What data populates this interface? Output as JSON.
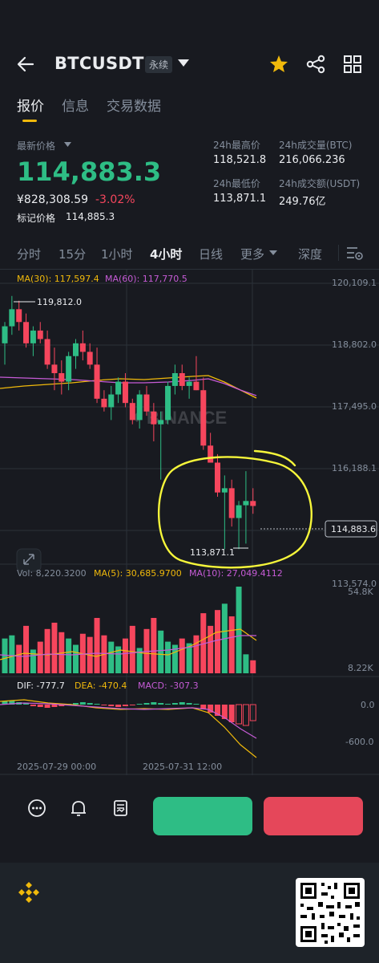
{
  "header": {
    "symbol": "BTCUSDT",
    "contract_type": "永续",
    "icons": [
      "back-arrow-icon",
      "dropdown-caret-icon",
      "star-icon",
      "share-icon",
      "grid-icon"
    ],
    "favorite_color": "#f0b90b"
  },
  "top_tabs": [
    {
      "label": "报价",
      "active": true
    },
    {
      "label": "信息",
      "active": false
    },
    {
      "label": "交易数据",
      "active": false
    }
  ],
  "price": {
    "last_price_label": "最新价格",
    "last_price": "114,883.3",
    "cny_price": "¥828,308.59",
    "change_pct": "-3.02%",
    "mark_label": "标记价格",
    "mark_value": "114,885.3"
  },
  "stats": {
    "high_label": "24h最高价",
    "high": "118,521.8",
    "low_label": "24h最低价",
    "low": "113,871.1",
    "vol_btc_label": "24h成交量(BTC)",
    "vol_btc": "216,066.236",
    "vol_usdt_label": "24h成交额(USDT)",
    "vol_usdt": "249.76亿"
  },
  "intervals": [
    {
      "label": "分时",
      "active": false
    },
    {
      "label": "15分",
      "active": false
    },
    {
      "label": "1小时",
      "active": false
    },
    {
      "label": "4小时",
      "active": true
    },
    {
      "label": "日线",
      "active": false
    },
    {
      "label": "更多",
      "active": false
    },
    {
      "label": "深度",
      "active": false
    }
  ],
  "indicators": {
    "ma30": "MA(30): 117,597.4",
    "ma60": "MA(60): 117,770.5",
    "vol": "Vol: 8,220.3200",
    "vol_ma5": "MA(5): 30,685.9700",
    "vol_ma10": "MA(10): 27,049.4112",
    "dif": "DIF: -777.7",
    "dea": "DEA: -470.4",
    "macd": "MACD: -307.3"
  },
  "chart_labels": {
    "price_axis": [
      "120,109.1",
      "118,802.0",
      "117,495.0",
      "116,188.1",
      "113,574.0"
    ],
    "current_price_tag": "114,883.6",
    "high_marker": "119,812.0",
    "low_marker": "113,871.1",
    "vol_axis": [
      "54.8K",
      "8.22K"
    ],
    "macd_axis": [
      "0.0",
      "-600.0"
    ],
    "time_axis": [
      "2025-07-29 00:00",
      "2025-07-31 12:00"
    ],
    "watermark": "BINANCE"
  },
  "chart_data": {
    "type": "candlestick",
    "interval": "4h",
    "ylim": [
      113574.0,
      120109.1
    ],
    "annotation": "yellow hand-drawn circle around the latest candles",
    "candles": [
      {
        "o": 118700,
        "h": 119200,
        "l": 118200,
        "c": 119100
      },
      {
        "o": 119100,
        "h": 119812,
        "l": 118900,
        "c": 119500
      },
      {
        "o": 119500,
        "h": 119700,
        "l": 119000,
        "c": 119200
      },
      {
        "o": 119200,
        "h": 119400,
        "l": 118600,
        "c": 118700
      },
      {
        "o": 118700,
        "h": 119100,
        "l": 118400,
        "c": 119000
      },
      {
        "o": 119000,
        "h": 119200,
        "l": 118700,
        "c": 118800
      },
      {
        "o": 118800,
        "h": 119000,
        "l": 118100,
        "c": 118200
      },
      {
        "o": 118200,
        "h": 118600,
        "l": 117600,
        "c": 118000
      },
      {
        "o": 118000,
        "h": 118300,
        "l": 117500,
        "c": 117800
      },
      {
        "o": 117800,
        "h": 118500,
        "l": 117600,
        "c": 118400
      },
      {
        "o": 118400,
        "h": 118800,
        "l": 118100,
        "c": 118700
      },
      {
        "o": 118700,
        "h": 119000,
        "l": 118300,
        "c": 118500
      },
      {
        "o": 118500,
        "h": 118700,
        "l": 118100,
        "c": 118200
      },
      {
        "o": 118200,
        "h": 118600,
        "l": 117300,
        "c": 117400
      },
      {
        "o": 117400,
        "h": 117600,
        "l": 117100,
        "c": 117200
      },
      {
        "o": 117200,
        "h": 117700,
        "l": 116900,
        "c": 117500
      },
      {
        "o": 117500,
        "h": 117900,
        "l": 117300,
        "c": 117800
      },
      {
        "o": 117800,
        "h": 118000,
        "l": 117200,
        "c": 117300
      },
      {
        "o": 117300,
        "h": 117400,
        "l": 116800,
        "c": 116900
      },
      {
        "o": 116900,
        "h": 117600,
        "l": 116700,
        "c": 117500
      },
      {
        "o": 117500,
        "h": 117700,
        "l": 117000,
        "c": 117100
      },
      {
        "o": 117100,
        "h": 117300,
        "l": 116400,
        "c": 116800
      },
      {
        "o": 116800,
        "h": 117100,
        "l": 115500,
        "c": 116900
      },
      {
        "o": 116900,
        "h": 117800,
        "l": 116800,
        "c": 117700
      },
      {
        "o": 117700,
        "h": 118200,
        "l": 117500,
        "c": 118000
      },
      {
        "o": 118000,
        "h": 118200,
        "l": 117600,
        "c": 117700
      },
      {
        "o": 117700,
        "h": 117900,
        "l": 117400,
        "c": 117800
      },
      {
        "o": 117800,
        "h": 118400,
        "l": 117600,
        "c": 117600
      },
      {
        "o": 117600,
        "h": 117900,
        "l": 116200,
        "c": 116300
      },
      {
        "o": 116300,
        "h": 116600,
        "l": 115900,
        "c": 115900
      },
      {
        "o": 115900,
        "h": 116100,
        "l": 115100,
        "c": 115200
      },
      {
        "o": 115200,
        "h": 115600,
        "l": 113871.1,
        "c": 115300
      },
      {
        "o": 115300,
        "h": 115500,
        "l": 114400,
        "c": 114600
      },
      {
        "o": 114600,
        "h": 115000,
        "l": 113871.1,
        "c": 114900
      },
      {
        "o": 114900,
        "h": 115700,
        "l": 114000,
        "c": 115000
      },
      {
        "o": 115000,
        "h": 115300,
        "l": 114700,
        "c": 114883.3
      }
    ],
    "volume": [
      22,
      24,
      18,
      30,
      15,
      20,
      28,
      32,
      26,
      22,
      18,
      25,
      23,
      35,
      24,
      20,
      17,
      22,
      30,
      16,
      28,
      35,
      27,
      20,
      18,
      22,
      19,
      24,
      38,
      30,
      40,
      44,
      36,
      54.8,
      12,
      8.22
    ]
  }
}
